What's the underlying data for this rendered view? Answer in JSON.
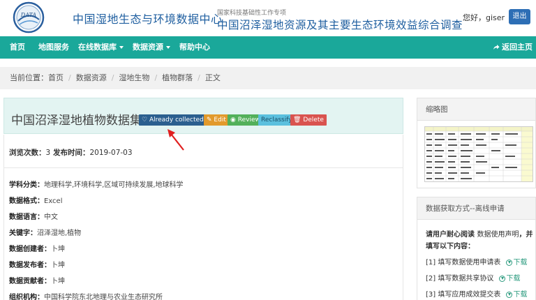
{
  "header": {
    "site_title": "中国湿地生态与环境数据中心",
    "project_subtitle": "国家科技基础性工作专项",
    "project_title": "中国沼泽湿地资源及其主要生态环境效益综合调查",
    "greeting": "您好，giser",
    "logout_label": "退出",
    "logo_text": "DATA"
  },
  "nav": {
    "items": [
      {
        "label": "首页"
      },
      {
        "label": "地图服务"
      },
      {
        "label": "在线数据库"
      },
      {
        "label": "数据资源"
      },
      {
        "label": "帮助中心"
      }
    ],
    "return_label": "返回主页"
  },
  "breadcrumb": {
    "prefix": "当前位置：",
    "items": [
      "首页",
      "数据资源",
      "湿地生物",
      "植物群落",
      "正文"
    ]
  },
  "dataset": {
    "title": "中国沼泽湿地植物数据集",
    "tags": {
      "collected": "Already collected",
      "edit": "Edit",
      "review": "Review",
      "reclassify": "Reclassify",
      "delete": "Delete"
    },
    "views_label": "浏览次数：",
    "views_value": "3",
    "published_label": "发布时间：",
    "published_value": "2019-07-03",
    "meta": [
      {
        "label": "学科分类：",
        "value": "地理科学,环境科学,区域可持续发展,地球科学"
      },
      {
        "label": "数据格式：",
        "value": "Excel"
      },
      {
        "label": "数据语言：",
        "value": "中文"
      },
      {
        "label": "关键字：",
        "value": "沼泽湿地,植物"
      },
      {
        "label": "数据创建者：",
        "value": "卜坤"
      },
      {
        "label": "数据发布者：",
        "value": "卜坤"
      },
      {
        "label": "数据贡献者：",
        "value": "卜坤"
      },
      {
        "label": "组织机构：",
        "value": "中国科学院东北地理与农业生态研究所"
      }
    ]
  },
  "sidebar": {
    "thumb_title": "缩略图",
    "access_title": "数据获取方式--离线申请",
    "notice_bold": "请用户耐心阅读",
    "notice_link": "数据使用声明",
    "notice_rest": "，并",
    "notice_line2": "填写以下内容：",
    "steps": [
      {
        "text": "[1] 填写数据使用申请表",
        "link": "下载"
      },
      {
        "text": "[2] 填写数据共享协议",
        "link": "下载"
      },
      {
        "text": "[3] 填写应用成效提交表",
        "link": "下载"
      }
    ]
  },
  "colors": {
    "nav_bg": "#1aa89a",
    "brand_blue": "#1f5fa0",
    "title_bar_bg": "#e3f4f2"
  }
}
